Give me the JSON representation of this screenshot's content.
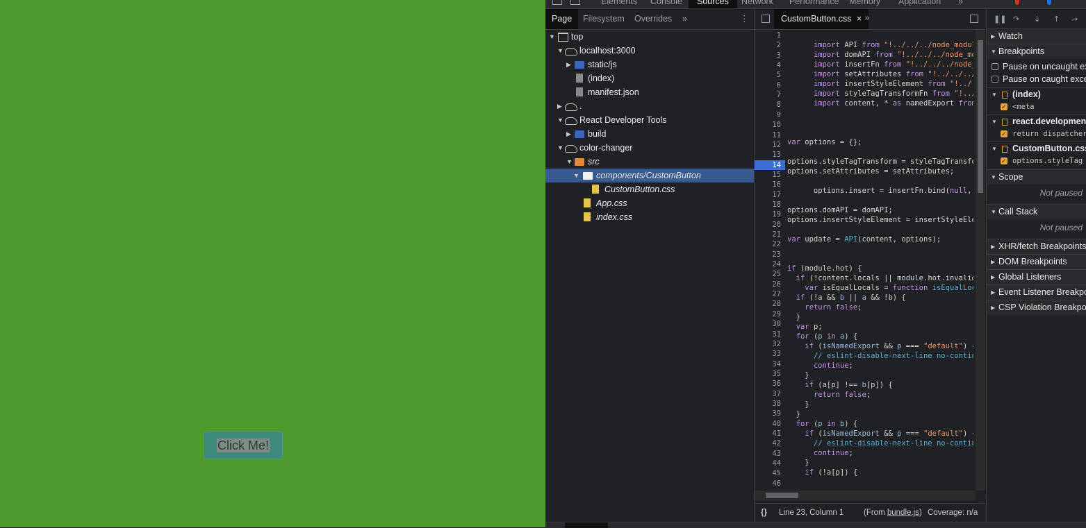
{
  "app": {
    "button_label": "Click Me!",
    "bg_color": "#4f9a2f",
    "button_color": "#3e8a7a"
  },
  "devtools": {
    "top_tabs": [
      "Elements",
      "Console",
      "Sources",
      "Network",
      "Performance",
      "Memory",
      "Application"
    ],
    "active_top_tab": "Sources",
    "more_tabs_icon": "»",
    "navigator": {
      "tabs": [
        "Page",
        "Filesystem",
        "Overrides"
      ],
      "more": "»",
      "menu": "⋮",
      "tree": [
        {
          "label": "top"
        },
        {
          "label": "localhost:3000"
        },
        {
          "label": "static/js"
        },
        {
          "label": "(index)"
        },
        {
          "label": "manifest.json"
        },
        {
          "label": "."
        },
        {
          "label": "React Developer Tools"
        },
        {
          "label": "build"
        },
        {
          "label": "color-changer"
        },
        {
          "label": "src"
        },
        {
          "label": "components/CustomButton"
        },
        {
          "label": "CustomButton.css"
        },
        {
          "label": "App.css"
        },
        {
          "label": "index.css"
        }
      ]
    },
    "editor": {
      "tab_label": "CustomButton.css",
      "close": "×",
      "more": "»",
      "breakpoint_line": 14,
      "line_numbers": [
        "1",
        "2",
        "3",
        "4",
        "5",
        "6",
        "7",
        "8",
        "9",
        "10",
        "11",
        "12",
        "13",
        "14",
        "15",
        "16",
        "17",
        "18",
        "19",
        "20",
        "21",
        "22",
        "23",
        "24",
        "25",
        "26",
        "27",
        "28",
        "29",
        "30",
        "31",
        "32",
        "33",
        "34",
        "35",
        "36",
        "37",
        "38",
        "39",
        "40",
        "41",
        "42",
        "43",
        "44",
        "45",
        "46"
      ],
      "status": {
        "braces": "{}",
        "position": "Line 23, Column 1",
        "from_prefix": "(From ",
        "from_link": "bundle.js",
        "from_suffix": ")",
        "coverage": "Coverage: n/a"
      }
    },
    "sidebar": {
      "watch": "Watch",
      "breakpoints": "Breakpoints",
      "pause_uncaught": "Pause on uncaught exceptions",
      "pause_caught": "Pause on caught exceptions",
      "bp_groups": [
        {
          "file": "(index)",
          "code": "<meta"
        },
        {
          "file": "react.development.js",
          "code": "return dispatcher"
        },
        {
          "file": "CustomButton.css",
          "code": "options.styleTag"
        }
      ],
      "scope": "Scope",
      "scope_status": "Not paused",
      "call_stack": "Call Stack",
      "call_stack_status": "Not paused",
      "sections": [
        "XHR/fetch Breakpoints",
        "DOM Breakpoints",
        "Global Listeners",
        "Event Listener Breakpoints",
        "CSP Violation Breakpoints"
      ]
    }
  }
}
